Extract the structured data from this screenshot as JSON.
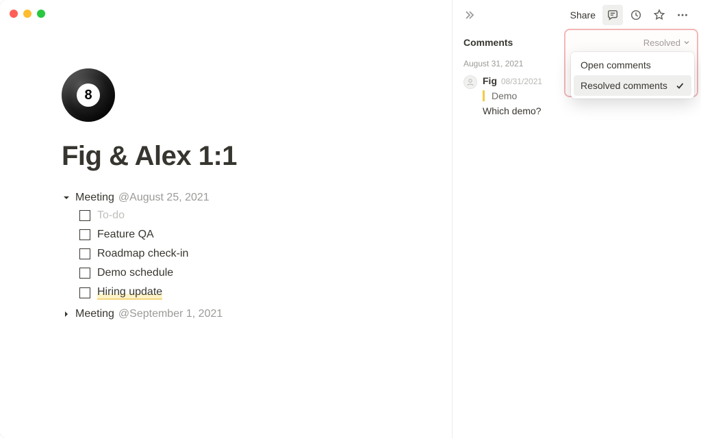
{
  "page": {
    "title": "Fig & Alex 1:1",
    "icon_name": "8ball-icon",
    "icon_glyph": "8"
  },
  "blocks": {
    "meeting1": {
      "label": "Meeting",
      "date": "@August 25, 2021",
      "expanded": true,
      "todos": [
        {
          "label": "To-do",
          "placeholder": true
        },
        {
          "label": "Feature QA",
          "placeholder": false
        },
        {
          "label": "Roadmap check-in",
          "placeholder": false
        },
        {
          "label": "Demo schedule",
          "placeholder": false
        },
        {
          "label": "Hiring update",
          "placeholder": false,
          "highlighted": true
        }
      ]
    },
    "meeting2": {
      "label": "Meeting",
      "date": "@September 1, 2021",
      "expanded": false
    }
  },
  "topbar": {
    "share": "Share"
  },
  "comments_panel": {
    "title": "Comments",
    "filter_label": "Resolved",
    "group_date": "August 31, 2021",
    "comment": {
      "author": "Fig",
      "date": "08/31/2021",
      "quote": "Demo",
      "text": "Which demo?"
    },
    "dropdown": {
      "open": "Open comments",
      "resolved": "Resolved comments"
    }
  }
}
